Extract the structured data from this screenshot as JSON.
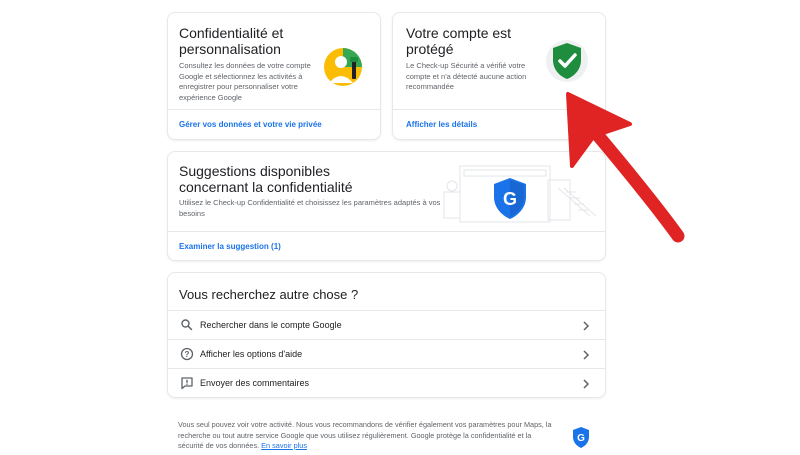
{
  "privacy_card": {
    "title": "Confidentialité et personnalisation",
    "description": "Consultez les données de votre compte Google et sélectionnez les activités à enregistrer pour personnaliser votre expérience Google",
    "link": "Gérer vos données et votre vie privée",
    "icon": "privacy-illustration-icon"
  },
  "security_card": {
    "title": "Votre compte est protégé",
    "description": "Le Check-up Sécurité a vérifié votre compte et n'a détecté aucune action recommandée",
    "link": "Afficher les détails",
    "icon": "shield-check-icon",
    "accent": "#1e8e3e"
  },
  "suggestions_card": {
    "title": "Suggestions disponibles concernant la confidentialité",
    "description": "Utilisez le Check-up Confidentialité et choisissez les paramètres adaptés à vos besoins",
    "link": "Examiner la suggestion (1)",
    "icon": "google-shield-icon",
    "accent": "#1a73e8"
  },
  "search_card": {
    "title": "Vous recherchez autre chose ?",
    "items": [
      {
        "label": "Rechercher dans le compte Google",
        "icon": "search-icon"
      },
      {
        "label": "Afficher les options d'aide",
        "icon": "help-icon"
      },
      {
        "label": "Envoyer des commentaires",
        "icon": "feedback-icon"
      }
    ]
  },
  "footer": {
    "text": "Vous seul pouvez voir votre activité. Nous vous recommandons de vérifier également vos paramètres pour Maps, la recherche ou tout autre service Google que vous utilisez régulièrement. Google protège la confidentialité et la sécurité de vos données.",
    "link": "En savoir plus"
  },
  "annotation": {
    "arrow_color": "#e02424"
  }
}
